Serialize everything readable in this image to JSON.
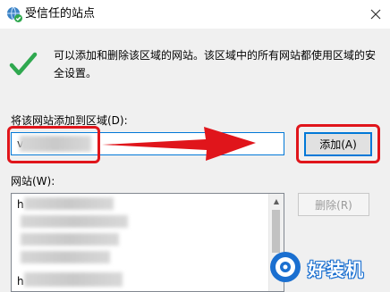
{
  "window": {
    "title": "受信任的站点",
    "title_icon": "globe-check-icon",
    "close_icon": "close-icon"
  },
  "info": {
    "icon": "green-check-icon",
    "text": "可以添加和删除该区域的网站。该区域中的所有网站都使用区域的安全设置。"
  },
  "add_site": {
    "label": "将该网站添加到区域(D):",
    "input_value": "v",
    "button_label": "添加(A)"
  },
  "sites": {
    "label": "网站(W):",
    "items": [
      "h",
      "h"
    ],
    "remove_label": "删除(R)"
  },
  "annotations": {
    "highlight_color": "#e0151b",
    "arrow_color": "#e0151b"
  },
  "watermark": {
    "text": "好装机",
    "logo": "watermark-logo-icon"
  },
  "colors": {
    "accent": "#0078d7",
    "check": "#2fa84f",
    "panel_bg": "#f0f0f0"
  }
}
